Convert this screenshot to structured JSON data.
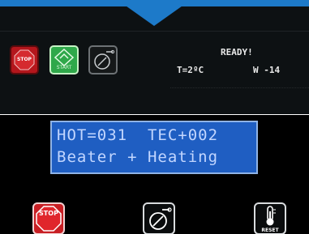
{
  "top_display": {
    "status": "READY!",
    "temperature": "T=2ºC",
    "power": "W  -14",
    "buttons": {
      "stop_label": "STOP",
      "start_label": "START"
    }
  },
  "lcd": {
    "line1": "HOT=031  TEC+002",
    "line2": "Beater + Heating"
  },
  "bottom_buttons": {
    "stop_label": "STOP",
    "reset_label": "RESET"
  },
  "colors": {
    "accent_blue": "#1d7ac9",
    "lcd_background": "#1f5ec2",
    "stop_red": "#c81f24",
    "start_green": "#2fa84a"
  },
  "icons": [
    "stop-sign-icon",
    "start-icon",
    "disk-key-icon",
    "thermometer-reset-icon"
  ]
}
